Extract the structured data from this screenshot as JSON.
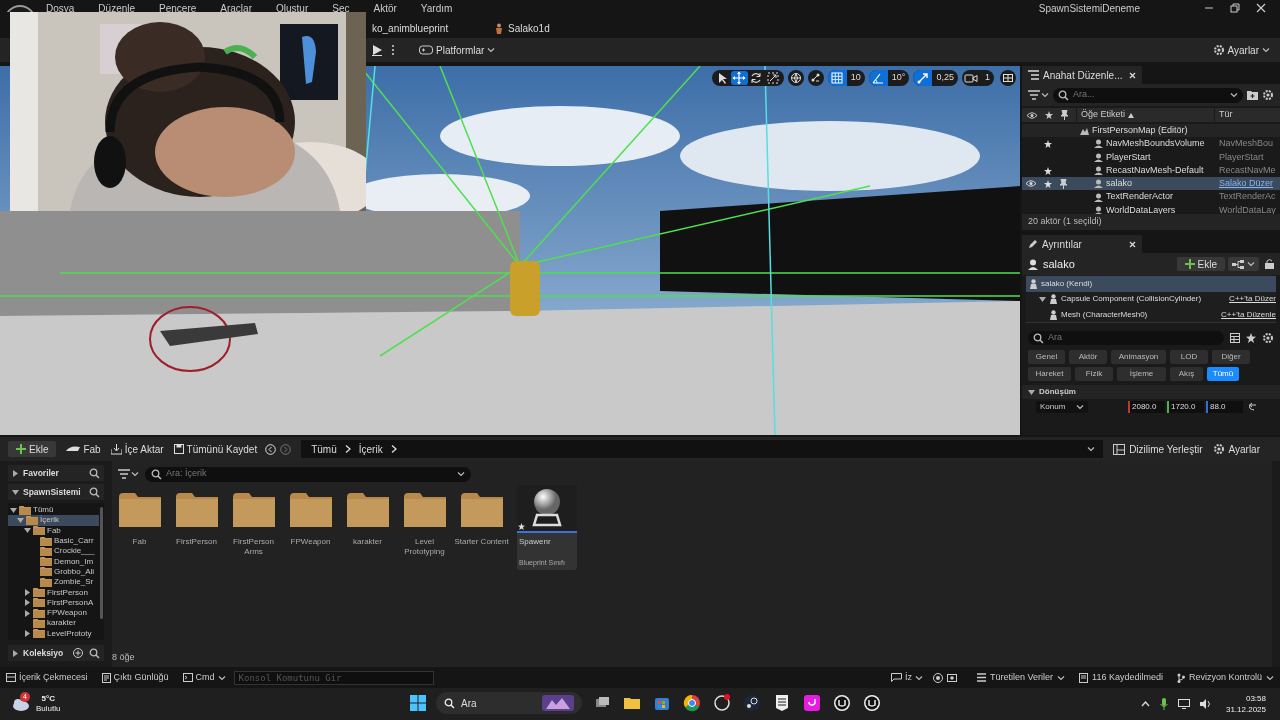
{
  "menu": [
    "Dosya",
    "Düzenle",
    "Pencere",
    "Araçlar",
    "Oluştur",
    "Seç",
    "Aktör",
    "Yardım"
  ],
  "window_title": "SpawnSistemiDeneme",
  "document_tabs": [
    "ko_animblueprint",
    "Salako1d"
  ],
  "toolbar": {
    "platforms": "Platformlar",
    "settings": "Ayarlar"
  },
  "viewport": {
    "tools": [
      {
        "kind": "select",
        "selected": false
      },
      {
        "kind": "move",
        "selected": true
      },
      {
        "kind": "rotate",
        "selected": false
      },
      {
        "kind": "scale",
        "selected": false
      }
    ],
    "snaps": [
      {
        "kind": "grid",
        "value": "10",
        "on": true
      },
      {
        "kind": "angle",
        "value": "10°",
        "on": true
      },
      {
        "kind": "scale",
        "value": "0,25",
        "on": true
      },
      {
        "kind": "camera",
        "value": "1",
        "on": false
      }
    ]
  },
  "outliner": {
    "tab": "Anahat Düzenle...",
    "search_placeholder": "Ara...",
    "columns": [
      "Öğe Etiketi",
      "Tür"
    ],
    "rows": [
      {
        "label": "FirstPersonMap (Editör)",
        "starred": false,
        "selected": false,
        "children": [
          {
            "label": "NavMeshBoundsVolume",
            "type": "NavMeshBou",
            "type_link": false,
            "starred": true,
            "selected": false
          },
          {
            "label": "PlayerStart",
            "type": "PlayerStart",
            "type_link": false,
            "starred": false,
            "selected": false
          },
          {
            "label": "RecastNavMesh-Default",
            "type": "RecastNavMe",
            "type_link": false,
            "starred": true,
            "selected": false
          },
          {
            "label": "salako",
            "type": "Salako Düzer",
            "type_link": true,
            "starred": true,
            "selected": true
          },
          {
            "label": "TextRenderActor",
            "type": "TextRenderAc",
            "type_link": false,
            "starred": false,
            "selected": false
          },
          {
            "label": "WorldDataLayers",
            "type": "WorldDataLay",
            "type_link": false,
            "starred": false,
            "selected": false
          }
        ]
      }
    ],
    "footer": "20 aktör (1 seçildi)"
  },
  "details": {
    "tab": "Ayrıntılar",
    "actor": "salako",
    "add_button": "Ekle",
    "components": [
      {
        "label": "salako (Kendi)",
        "selected": true,
        "children": [
          {
            "label": "Capsule Component (CollisionCylinder)",
            "link": "C++'ta Düzer",
            "selected": false,
            "expanded": true,
            "children": [
              {
                "label": "Mesh (CharacterMesh0)",
                "link": "C++'ta Düzenle",
                "selected": false
              }
            ]
          }
        ]
      }
    ],
    "search_placeholder": "Ara",
    "filters": [
      {
        "label": "Genel",
        "selected": false
      },
      {
        "label": "Aktör",
        "selected": false
      },
      {
        "label": "Animasyon",
        "selected": false
      },
      {
        "label": "LOD",
        "selected": false
      },
      {
        "label": "Diğer",
        "selected": false
      },
      {
        "label": "Hareket",
        "selected": false
      },
      {
        "label": "Fizik",
        "selected": false
      },
      {
        "label": "İşleme",
        "selected": false
      },
      {
        "label": "Akış",
        "selected": false
      },
      {
        "label": "Tümü",
        "selected": true
      }
    ],
    "section": "Dönüşüm",
    "property": "Konum",
    "values": [
      {
        "value": "2080.0",
        "color": "#c0392b"
      },
      {
        "value": "1720.0",
        "color": "#4caf50"
      },
      {
        "value": "88.0",
        "color": "#2f6fdc"
      }
    ]
  },
  "content_browser": {
    "actions": [
      "Ekle",
      "Fab",
      "İçe Aktar",
      "Tümünü Kaydet"
    ],
    "breadcrumb": [
      "Tümü",
      "İçerik"
    ],
    "right_actions": [
      "Dizilime Yerleştir",
      "Ayarlar"
    ],
    "favorites": "Favoriler",
    "project": "SpawnSistemi",
    "collections": "Koleksiyo",
    "tree": [
      {
        "label": "Tümü",
        "expanded": true,
        "selected": false,
        "children": [
          {
            "label": "İçerik",
            "expanded": true,
            "selected": true,
            "children": [
              {
                "label": "Fab",
                "expanded": true,
                "selected": false,
                "children": [
                  {
                    "label": "Basic_Carr",
                    "selected": false
                  },
                  {
                    "label": "Crockie___",
                    "selected": false
                  },
                  {
                    "label": "Demon_Im",
                    "selected": false
                  },
                  {
                    "label": "Grobbo_Ali",
                    "selected": false
                  },
                  {
                    "label": "Zombie_Sr",
                    "selected": false
                  }
                ]
              },
              {
                "label": "FirstPerson",
                "expanded": false,
                "selected": false
              },
              {
                "label": "FirstPersonA",
                "expanded": false,
                "selected": false
              },
              {
                "label": "FPWeapon",
                "expanded": false,
                "selected": false
              },
              {
                "label": "karakter",
                "selected": false
              },
              {
                "label": "LevelPrototy",
                "expanded": false,
                "selected": false
              }
            ]
          }
        ]
      }
    ],
    "search_placeholder": "Ara: İçerik",
    "items": [
      {
        "kind": "folder",
        "label": "Fab"
      },
      {
        "kind": "folder",
        "label": "FirstPerson"
      },
      {
        "kind": "folder",
        "label": "FirstPerson Arms"
      },
      {
        "kind": "folder",
        "label": "FPWeapon"
      },
      {
        "kind": "folder",
        "label": "karakter"
      },
      {
        "kind": "folder",
        "label": "Level Prototyping"
      },
      {
        "kind": "folder",
        "label": "Starter Content"
      },
      {
        "kind": "asset",
        "label": "Spawenr",
        "type": "Blueprint Sınıfı"
      }
    ],
    "count": "8 öğe"
  },
  "status_bar": {
    "left": [
      "İçerik Çekmecesi",
      "Çıktı Günlüğü"
    ],
    "cmd": "Cmd",
    "console_placeholder": "Konsol Komutunu Gir",
    "trace": "İz",
    "right": [
      "Türetilen Veriler",
      "116 Kaydedilmedi",
      "Revizyon Kontrolü"
    ]
  },
  "taskbar": {
    "weather_badge": "4",
    "temperature": "5°C",
    "weather": "Bulutlu",
    "search": "Ara",
    "time": "03:58",
    "date": "31.12.2025"
  }
}
